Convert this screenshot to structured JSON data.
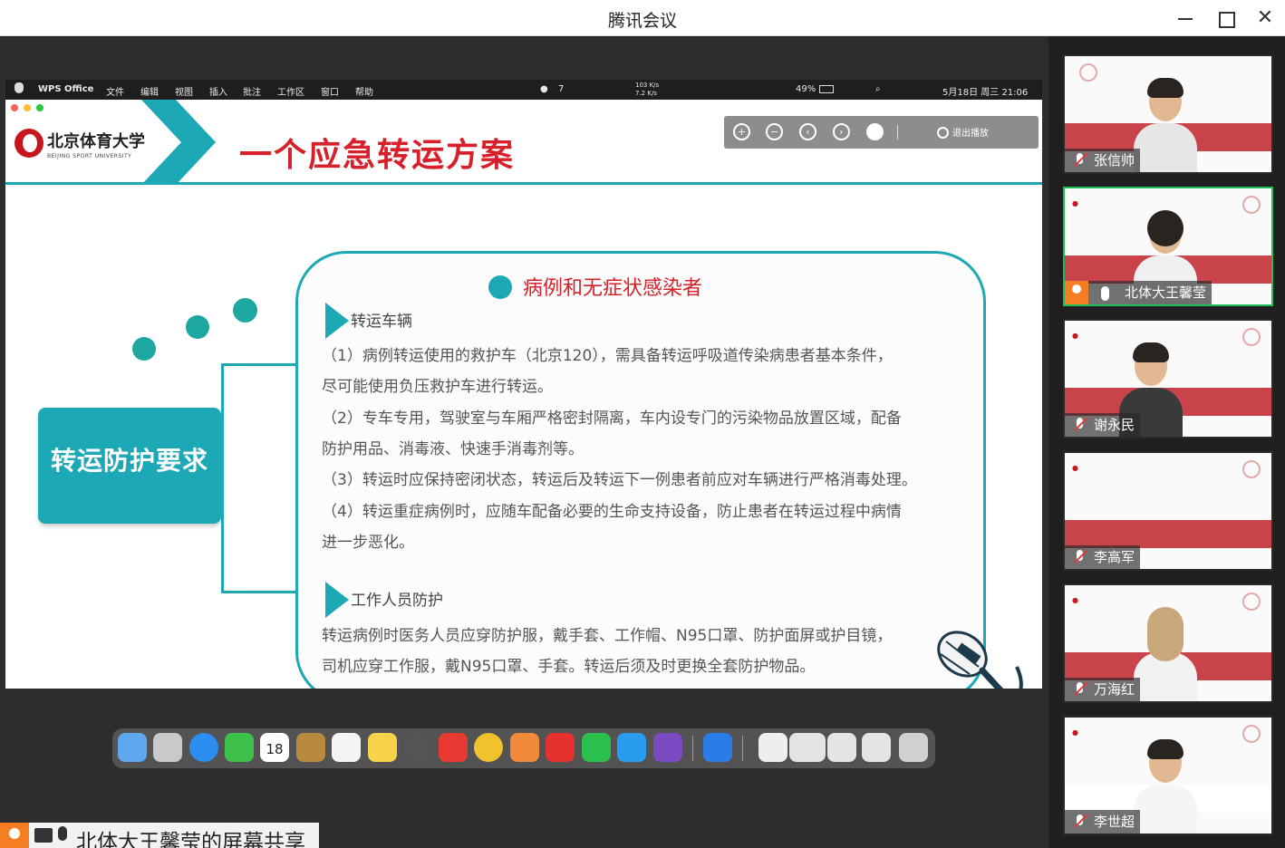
{
  "window": {
    "title": "腾讯会议",
    "close_glyph": "✕"
  },
  "mac_menu": {
    "left_items": [
      "WPS Office",
      "文件",
      "编辑",
      "视图",
      "插入",
      "批注",
      "工作区",
      "窗口",
      "帮助"
    ],
    "status_wechat_count": "7",
    "net_up": "103 K/s",
    "net_down": "7.2 K/s",
    "battery": "49%",
    "datetime": "5月18日 周三 21:06"
  },
  "slide": {
    "logo_cn": "北京体育大学",
    "logo_en": "BEIJING SPORT UNIVERSITY",
    "title": "一个应急转运方案",
    "toolbar": {
      "exit_label": "退出播放"
    },
    "main_box_label": "转运防护要求",
    "content_heading": "病例和无症状感染者",
    "section1_title": "转运车辆",
    "section1_lines": [
      "（1）病例转运使用的救护车（北京120），需具备转运呼吸道传染病患者基本条件，",
      "尽可能使用负压救护车进行转运。",
      "（2）专车专用，驾驶室与车厢严格密封隔离，车内设专门的污染物品放置区域，配备",
      "防护用品、消毒液、快速手消毒剂等。",
      "（3）转运时应保持密闭状态，转运后及转运下一例患者前应对车辆进行严格消毒处理。",
      "（4）转运重症病例时，应随车配备必要的生命支持设备，防止患者在转运过程中病情",
      "进一步恶化。"
    ],
    "section2_title": "工作人员防护",
    "section2_lines": [
      "  转运病例时医务人员应穿防护服，戴手套、工作帽、N95口罩、防护面屏或护目镜，",
      "司机应穿工作服，戴N95口罩、手套。转运后须及时更换全套防护物品。"
    ]
  },
  "dock": {
    "calendar_day": "18"
  },
  "share_banner": {
    "text": "北体大王馨莹的屏幕共享"
  },
  "participants": [
    {
      "name": "张信帅"
    },
    {
      "name": "北体大王馨莹"
    },
    {
      "name": "谢永民"
    },
    {
      "name": "李高军"
    },
    {
      "name": "万海红"
    },
    {
      "name": "李世超"
    }
  ],
  "colors": {
    "accent_teal": "#1ca8b4",
    "title_red": "#d7202a",
    "host_orange": "#f57e22",
    "active_green": "#1dbd58"
  }
}
